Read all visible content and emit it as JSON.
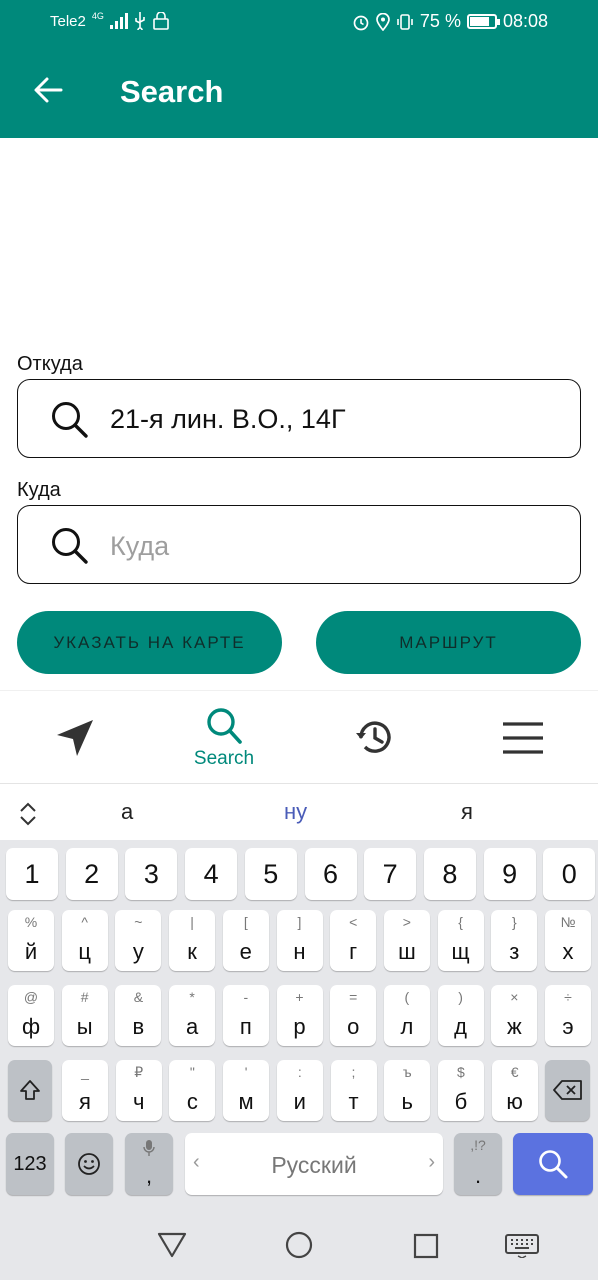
{
  "status_bar": {
    "carrier": "Tele2",
    "network": "4G",
    "battery": "75 %",
    "battery_level": 0.75,
    "time": "08:08"
  },
  "app_bar": {
    "title": "Search",
    "back_icon": "arrow-left-icon"
  },
  "form": {
    "from_label": "Откуда",
    "from_value": "21-я лин. В.О., 14Г",
    "to_label": "Куда",
    "to_placeholder": "Куда",
    "btn_map": "УКАЗАТЬ НА КАРТЕ",
    "btn_route": "МАРШРУТ"
  },
  "bottom_nav": {
    "search_label": "Search"
  },
  "keyboard": {
    "suggestions": [
      "а",
      "ну",
      "я"
    ],
    "numbers": [
      "1",
      "2",
      "3",
      "4",
      "5",
      "6",
      "7",
      "8",
      "9",
      "0"
    ],
    "row1": [
      [
        "%",
        "й"
      ],
      [
        "^",
        "ц"
      ],
      [
        "~",
        "у"
      ],
      [
        "|",
        "к"
      ],
      [
        "[",
        "е"
      ],
      [
        "]",
        "н"
      ],
      [
        "<",
        "г"
      ],
      [
        ">",
        "ш"
      ],
      [
        "{",
        "щ"
      ],
      [
        "}",
        "з"
      ],
      [
        "№",
        "х"
      ]
    ],
    "row2": [
      [
        "@",
        "ф"
      ],
      [
        "#",
        "ы"
      ],
      [
        "&",
        "в"
      ],
      [
        "*",
        "а"
      ],
      [
        "-",
        "п"
      ],
      [
        "+",
        "р"
      ],
      [
        "=",
        "о"
      ],
      [
        "(",
        "л"
      ],
      [
        ")",
        "д"
      ],
      [
        "×",
        "ж"
      ],
      [
        "÷",
        "э"
      ]
    ],
    "row3": [
      [
        "_",
        "я"
      ],
      [
        "₽",
        "ч"
      ],
      [
        "\"",
        "с"
      ],
      [
        "'",
        "м"
      ],
      [
        ":",
        "и"
      ],
      [
        ";",
        "т"
      ],
      [
        "ъ",
        "ь"
      ],
      [
        "$",
        "б"
      ],
      [
        "€",
        "ю"
      ]
    ],
    "mode_key": "123",
    "space_label": "Русский",
    "punct_sub": ",!?",
    "punct_main": ".",
    "comma": ","
  },
  "colors": {
    "primary": "#00897b",
    "keyboard_bg": "#e6e7ea",
    "action_key": "#5b72e0"
  }
}
